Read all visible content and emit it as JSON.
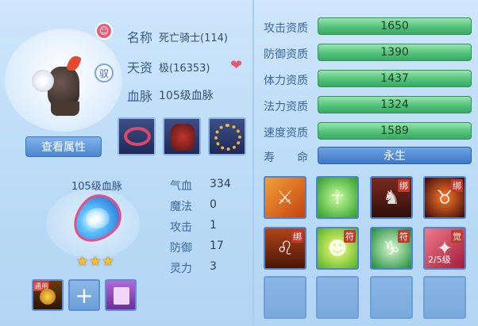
{
  "pet": {
    "name_label": "名称",
    "name_value": "死亡骑士(114)",
    "talent_label": "天资",
    "talent_value": "极(16353)",
    "bloodline_label": "血脉",
    "bloodline_value": "105级血脉",
    "badge_zhi": "驭",
    "badge_pet": "☺"
  },
  "buttons": {
    "view_attr": "查看属性"
  },
  "bloodline_panel": {
    "title": "105级血脉",
    "stars": "★★★"
  },
  "stats": [
    {
      "label": "气血",
      "value": "334"
    },
    {
      "label": "魔法",
      "value": "0"
    },
    {
      "label": "攻击",
      "value": "1"
    },
    {
      "label": "防御",
      "value": "17"
    },
    {
      "label": "灵力",
      "value": "3"
    }
  ],
  "slots": {
    "rune_tag": "通用",
    "add_symbol": "+"
  },
  "qualities": [
    {
      "label": "攻击资质",
      "value": "1650"
    },
    {
      "label": "防御资质",
      "value": "1390"
    },
    {
      "label": "体力资质",
      "value": "1437"
    },
    {
      "label": "法力资质",
      "value": "1324"
    },
    {
      "label": "速度资质",
      "value": "1589"
    }
  ],
  "life": {
    "label": "寿　　命",
    "value": "永生"
  },
  "skills": [
    {
      "tag": "",
      "level": ""
    },
    {
      "tag": "",
      "level": ""
    },
    {
      "tag": "绑",
      "level": ""
    },
    {
      "tag": "绑",
      "level": ""
    },
    {
      "tag": "绑",
      "level": ""
    },
    {
      "tag": "符",
      "level": ""
    },
    {
      "tag": "符",
      "level": ""
    },
    {
      "tag": "觉",
      "level": "2/5级"
    }
  ],
  "colors": {
    "quality_bar": "#52c27a",
    "life_bar": "#3d77c6",
    "accent": "#4d86cf",
    "heart": "#e4576c"
  }
}
